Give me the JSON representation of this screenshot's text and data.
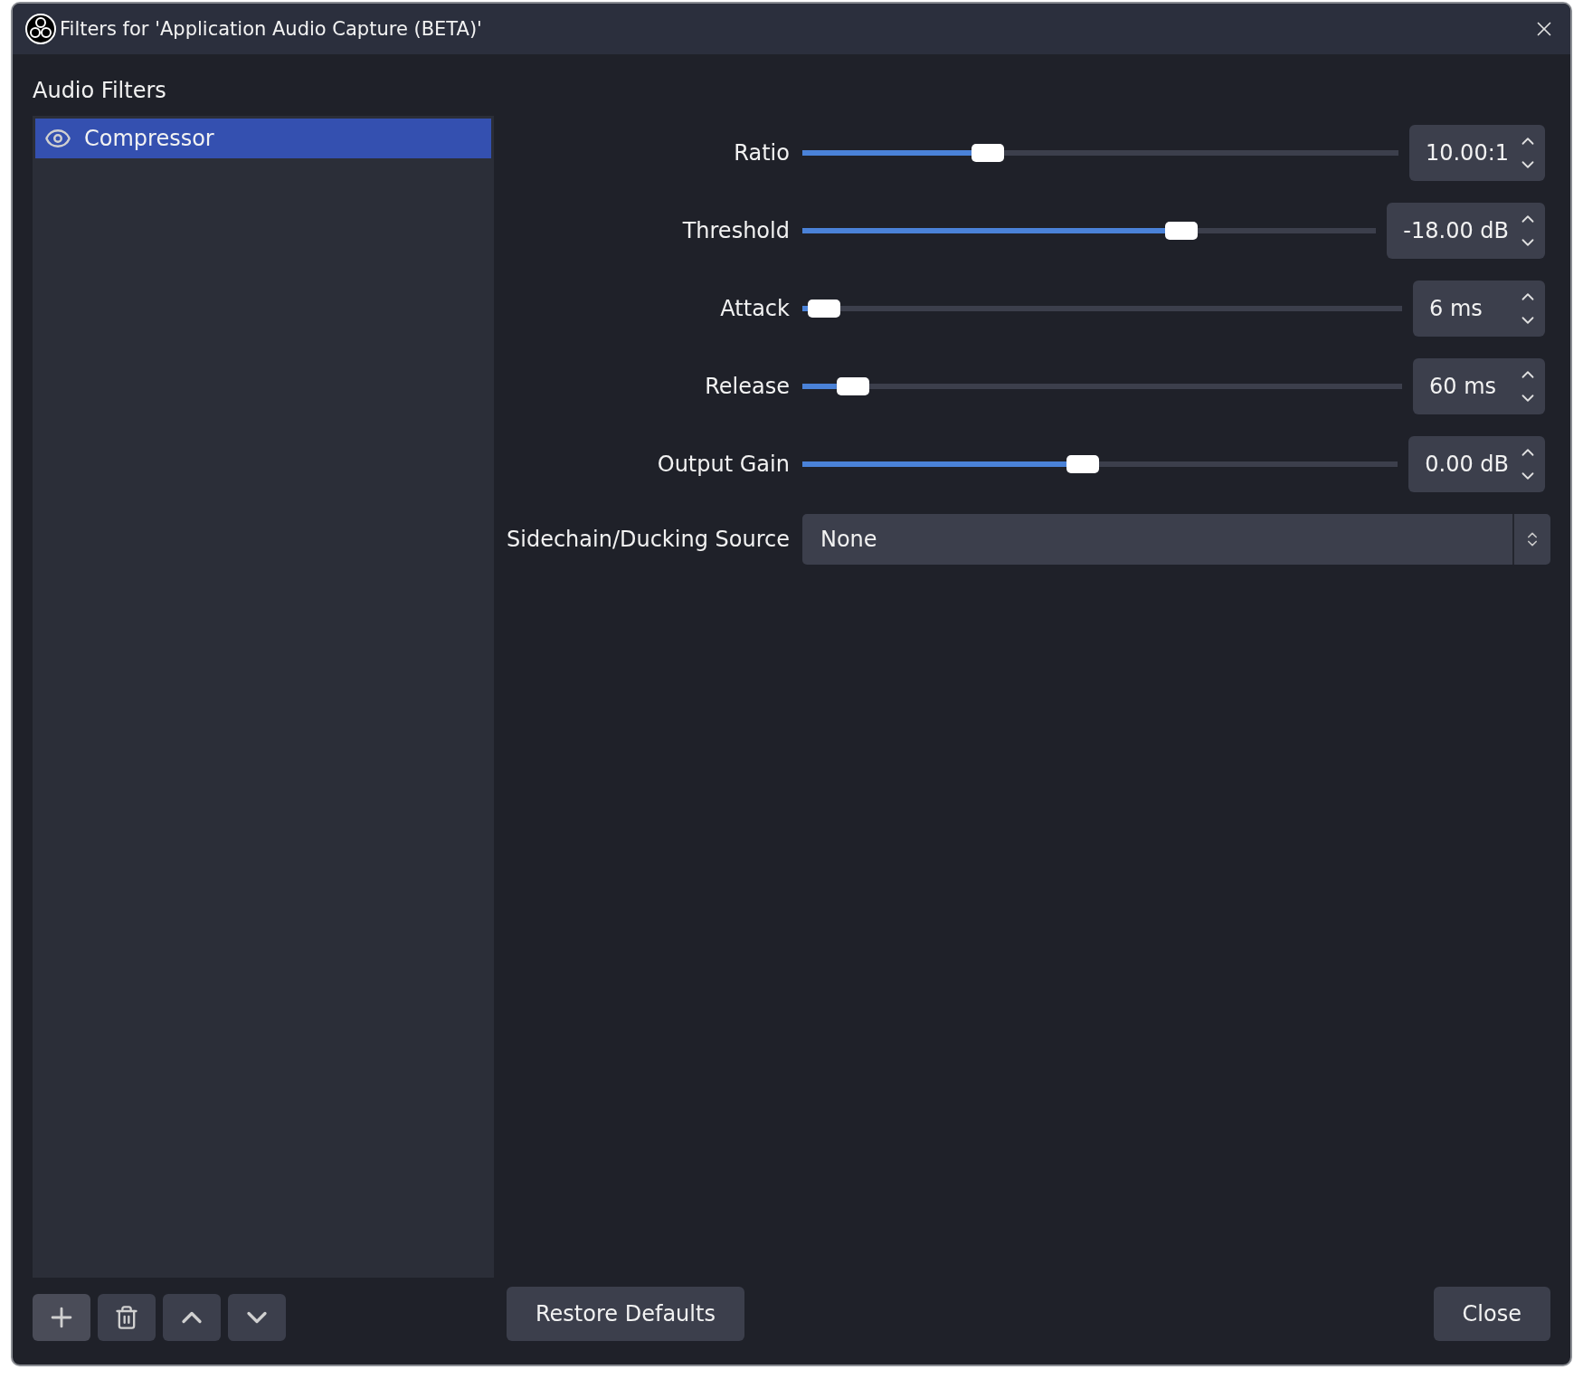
{
  "window": {
    "title": "Filters for 'Application Audio Capture (BETA)'"
  },
  "filters_panel": {
    "heading": "Audio Filters",
    "items": [
      {
        "label": "Compressor",
        "visible": true,
        "selected": true
      }
    ]
  },
  "controls": [
    {
      "label": "Ratio",
      "level": 0.3,
      "value": "10.00:1"
    },
    {
      "label": "Threshold",
      "level": 0.67,
      "value": "-18.00 dB"
    },
    {
      "label": "Attack",
      "level": 0.01,
      "value": "6 ms"
    },
    {
      "label": "Release",
      "level": 0.06,
      "value": "60 ms"
    },
    {
      "label": "Output Gain",
      "level": 0.47,
      "value": "0.00 dB"
    }
  ],
  "sidechain": {
    "label": "Sidechain/Ducking Source",
    "value": "None"
  },
  "buttons": {
    "restore": "Restore Defaults",
    "close": "Close"
  }
}
